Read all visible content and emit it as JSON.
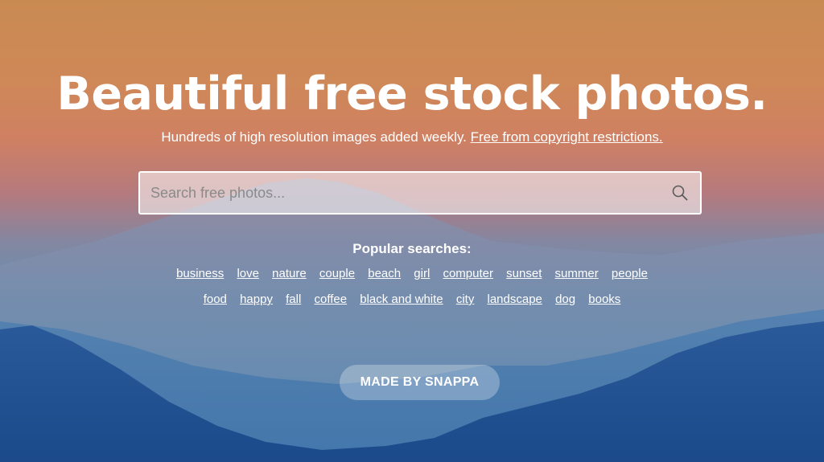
{
  "hero": {
    "title": "Beautiful free stock photos.",
    "subtitle": "Hundreds of high resolution images added weekly.",
    "subtitle_link": "Free from copyright restrictions."
  },
  "search": {
    "placeholder": "Search free photos...",
    "icon": "search-icon"
  },
  "popular": {
    "label": "Popular searches:",
    "row1": [
      "business",
      "love",
      "nature",
      "couple",
      "beach",
      "girl",
      "computer",
      "sunset",
      "summer",
      "people"
    ],
    "row2": [
      "food",
      "happy",
      "fall",
      "coffee",
      "black and white",
      "city",
      "landscape",
      "dog",
      "books"
    ]
  },
  "footer": {
    "made_by_label": "MADE BY SNAPPA"
  },
  "colors": {
    "sky_top": "#c98a52",
    "sky_mid": "#cf8062",
    "mountain_far": "#5f84a8",
    "mountain_near": "#1f4f8e"
  }
}
